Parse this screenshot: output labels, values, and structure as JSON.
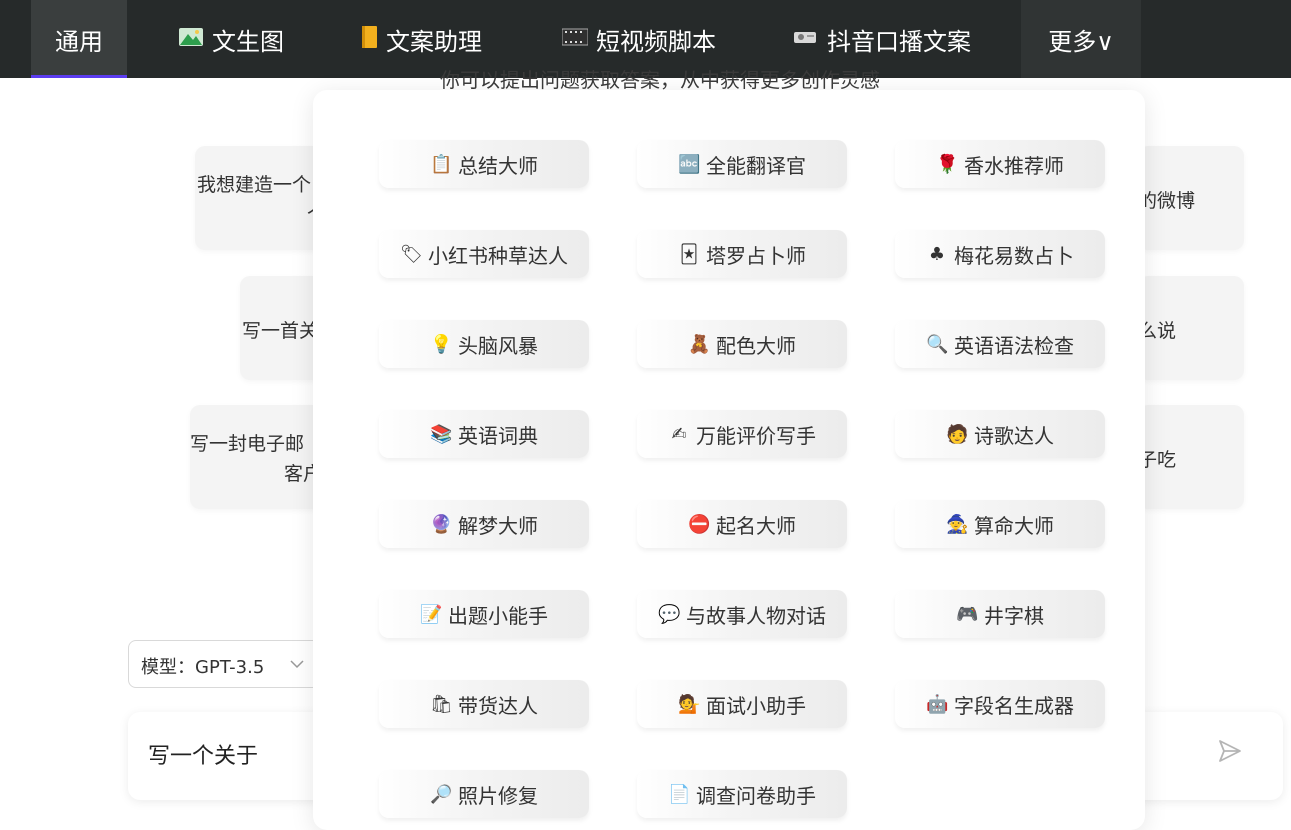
{
  "nav": {
    "tabs": [
      {
        "label": "通用",
        "icon": ""
      },
      {
        "label": "文生图",
        "icon": "mountain-icon"
      },
      {
        "label": "文案助理",
        "icon": "notebook-icon"
      },
      {
        "label": "短视频脚本",
        "icon": "film-icon"
      },
      {
        "label": "抖音口播文案",
        "icon": "projector-icon"
      },
      {
        "label": "更多∨",
        "icon": ""
      }
    ],
    "active_color": "#5b3cf0"
  },
  "main": {
    "subtitle": "你可以提出问题获取答案，从中获得更多创作灵感",
    "cards": [
      {
        "line1": "我想建造一个",
        "line2": "个"
      },
      {
        "line1": "的微博",
        "line2": ""
      },
      {
        "line1": "写一首关",
        "line2": ""
      },
      {
        "line1": "么说",
        "line2": ""
      },
      {
        "line1": "写一封电子邮",
        "line2": "客户"
      },
      {
        "line1": "子吃",
        "line2": ""
      }
    ]
  },
  "model_select": {
    "label": "模型：GPT-3.5"
  },
  "input": {
    "text": "写一个关于"
  },
  "dropdown": {
    "items": [
      {
        "label": "总结大师",
        "icon": "📋"
      },
      {
        "label": "全能翻译官",
        "icon": "🔤"
      },
      {
        "label": "香水推荐师",
        "icon": "🌹"
      },
      {
        "label": "小红书种草达人",
        "icon": "🏷"
      },
      {
        "label": "塔罗占卜师",
        "icon": "🃏"
      },
      {
        "label": "梅花易数占卜",
        "icon": "♣"
      },
      {
        "label": "头脑风暴",
        "icon": "💡"
      },
      {
        "label": "配色大师",
        "icon": "🧸"
      },
      {
        "label": "英语语法检查",
        "icon": "🔍"
      },
      {
        "label": "英语词典",
        "icon": "📚"
      },
      {
        "label": "万能评价写手",
        "icon": "✍"
      },
      {
        "label": "诗歌达人",
        "icon": "🧑"
      },
      {
        "label": "解梦大师",
        "icon": "🔮"
      },
      {
        "label": "起名大师",
        "icon": "⛔"
      },
      {
        "label": "算命大师",
        "icon": "🧙"
      },
      {
        "label": "出题小能手",
        "icon": "📝"
      },
      {
        "label": "与故事人物对话",
        "icon": "💬"
      },
      {
        "label": "井字棋",
        "icon": "🎮"
      },
      {
        "label": "带货达人",
        "icon": "🛍"
      },
      {
        "label": "面试小助手",
        "icon": "💁"
      },
      {
        "label": "字段名生成器",
        "icon": "🤖"
      },
      {
        "label": "照片修复",
        "icon": "🔎"
      },
      {
        "label": "调查问卷助手",
        "icon": "📄"
      }
    ]
  }
}
